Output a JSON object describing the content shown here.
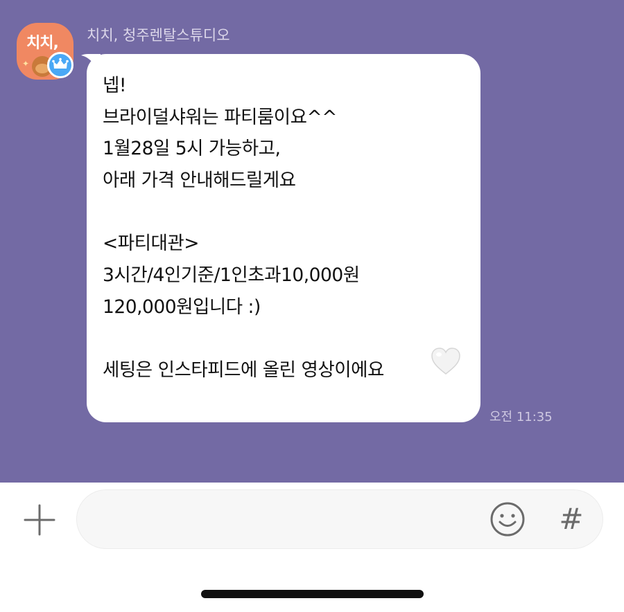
{
  "chat": {
    "sender": {
      "name": "치치, 청주렌탈스튜디오",
      "avatar_text": "치치,",
      "avatar_color": "#f08862",
      "badge_icon": "crown-icon",
      "badge_color": "#4aa8f5"
    },
    "message": {
      "lines": [
        "넵!",
        "브라이덜샤워는 파티룸이요^^",
        "1월28일 5시 가능하고,",
        "아래 가격 안내해드릴게요",
        "",
        "<파티대관>",
        "3시간/4인기준/1인초과10,000원",
        "120,000원입니다 :)",
        "",
        "세팅은 인스타피드에 올린 영상이에요"
      ],
      "trailing_emoji": "white-heart-emoji",
      "time": "오전 11:35"
    },
    "background_color": "#736aa4"
  },
  "composer": {
    "plus_icon": "plus-icon",
    "input_value": "",
    "emoji_icon": "smile-icon",
    "hash_label": "#"
  }
}
